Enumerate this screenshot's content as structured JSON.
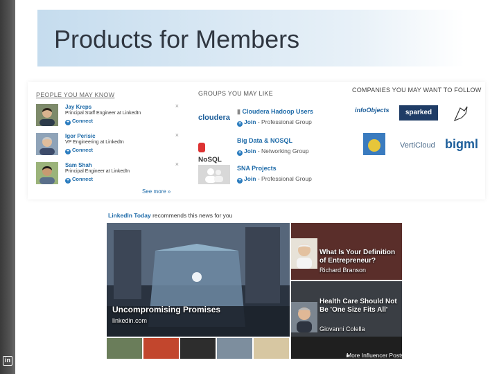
{
  "slide": {
    "title": "Products for Members",
    "logo_text": "in"
  },
  "people": {
    "section_title": "People You May Know",
    "items": [
      {
        "name": "Jay Kreps",
        "role": "Principal Staff Engineer at LinkedIn",
        "action": "Connect"
      },
      {
        "name": "Igor Perisic",
        "role": "VP Engineering at LinkedIn",
        "action": "Connect"
      },
      {
        "name": "Sam Shah",
        "role": "Principal Engineer at LinkedIn",
        "action": "Connect"
      }
    ],
    "dismiss_glyph": "×",
    "see_more": "See more »"
  },
  "groups": {
    "section_title": "Groups You May Like",
    "items": [
      {
        "logo_text": "cloudera",
        "name": "Cloudera Hadoop Users",
        "join": "Join",
        "type": "Professional Group"
      },
      {
        "logo_text": "NoSQL",
        "name": "Big Data & NOSQL",
        "join": "Join",
        "type": "Networking Group"
      },
      {
        "logo_text": "",
        "name": "SNA Projects",
        "join": "Join",
        "type": "Professional Group"
      }
    ]
  },
  "companies": {
    "section_title": "Companies You May Want To Follow",
    "logos": [
      "infoObjects",
      "sparked",
      "VertiCloud",
      "bigml"
    ]
  },
  "news": {
    "brand": "LinkedIn Today",
    "headline_suffix": " recommends this news for you",
    "hero": {
      "title": "Uncompromising Promises",
      "source": "linkedin.com"
    },
    "stories": [
      {
        "title": "What Is Your Definition of Entrepreneur?",
        "author": "Richard Branson"
      },
      {
        "title": "Health Care Should Not Be 'One Size Fits All'",
        "author": "Giovanni Colella"
      }
    ],
    "more_link": "More Influencer Posts",
    "more_arrow": "▸"
  },
  "colors": {
    "link_blue": "#1d6aa8",
    "banner": "#c5dcee"
  }
}
